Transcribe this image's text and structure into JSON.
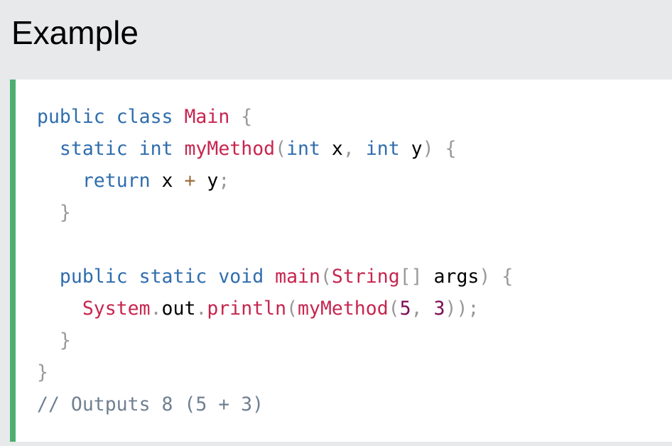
{
  "heading": "Example",
  "colors": {
    "page_background": "#e7e9eb",
    "code_background": "#ffffff",
    "accent_border": "#4caf70",
    "keyword": "#2f6dad",
    "name": "#c7254e",
    "punctuation": "#999999",
    "identifier": "#000000",
    "operator": "#9a6e3a",
    "number": "#7a0d55",
    "comment": "#708090"
  },
  "code": {
    "language": "java",
    "lines": [
      [
        {
          "t": "public",
          "k": "keyword"
        },
        {
          "t": " ",
          "k": "space"
        },
        {
          "t": "class",
          "k": "keyword"
        },
        {
          "t": " ",
          "k": "space"
        },
        {
          "t": "Main",
          "k": "name"
        },
        {
          "t": " ",
          "k": "space"
        },
        {
          "t": "{",
          "k": "punct"
        }
      ],
      [
        {
          "t": "  ",
          "k": "space"
        },
        {
          "t": "static",
          "k": "keyword"
        },
        {
          "t": " ",
          "k": "space"
        },
        {
          "t": "int",
          "k": "keyword"
        },
        {
          "t": " ",
          "k": "space"
        },
        {
          "t": "myMethod",
          "k": "name"
        },
        {
          "t": "(",
          "k": "punct"
        },
        {
          "t": "int",
          "k": "keyword"
        },
        {
          "t": " ",
          "k": "space"
        },
        {
          "t": "x",
          "k": "ident"
        },
        {
          "t": ",",
          "k": "punct"
        },
        {
          "t": " ",
          "k": "space"
        },
        {
          "t": "int",
          "k": "keyword"
        },
        {
          "t": " ",
          "k": "space"
        },
        {
          "t": "y",
          "k": "ident"
        },
        {
          "t": ")",
          "k": "punct"
        },
        {
          "t": " ",
          "k": "space"
        },
        {
          "t": "{",
          "k": "punct"
        }
      ],
      [
        {
          "t": "    ",
          "k": "space"
        },
        {
          "t": "return",
          "k": "keyword"
        },
        {
          "t": " ",
          "k": "space"
        },
        {
          "t": "x",
          "k": "ident"
        },
        {
          "t": " ",
          "k": "space"
        },
        {
          "t": "+",
          "k": "op"
        },
        {
          "t": " ",
          "k": "space"
        },
        {
          "t": "y",
          "k": "ident"
        },
        {
          "t": ";",
          "k": "punct"
        }
      ],
      [
        {
          "t": "  ",
          "k": "space"
        },
        {
          "t": "}",
          "k": "punct"
        }
      ],
      [],
      [
        {
          "t": "  ",
          "k": "space"
        },
        {
          "t": "public",
          "k": "keyword"
        },
        {
          "t": " ",
          "k": "space"
        },
        {
          "t": "static",
          "k": "keyword"
        },
        {
          "t": " ",
          "k": "space"
        },
        {
          "t": "void",
          "k": "keyword"
        },
        {
          "t": " ",
          "k": "space"
        },
        {
          "t": "main",
          "k": "name"
        },
        {
          "t": "(",
          "k": "punct"
        },
        {
          "t": "String",
          "k": "name"
        },
        {
          "t": "[]",
          "k": "punct"
        },
        {
          "t": " ",
          "k": "space"
        },
        {
          "t": "args",
          "k": "ident"
        },
        {
          "t": ")",
          "k": "punct"
        },
        {
          "t": " ",
          "k": "space"
        },
        {
          "t": "{",
          "k": "punct"
        }
      ],
      [
        {
          "t": "    ",
          "k": "space"
        },
        {
          "t": "System",
          "k": "name"
        },
        {
          "t": ".",
          "k": "punct"
        },
        {
          "t": "out",
          "k": "ident"
        },
        {
          "t": ".",
          "k": "punct"
        },
        {
          "t": "println",
          "k": "name"
        },
        {
          "t": "(",
          "k": "punct"
        },
        {
          "t": "myMethod",
          "k": "name"
        },
        {
          "t": "(",
          "k": "punct"
        },
        {
          "t": "5",
          "k": "number"
        },
        {
          "t": ",",
          "k": "punct"
        },
        {
          "t": " ",
          "k": "space"
        },
        {
          "t": "3",
          "k": "number"
        },
        {
          "t": "))",
          "k": "punct"
        },
        {
          "t": ";",
          "k": "punct"
        }
      ],
      [
        {
          "t": "  ",
          "k": "space"
        },
        {
          "t": "}",
          "k": "punct"
        }
      ],
      [
        {
          "t": "}",
          "k": "punct"
        }
      ],
      [
        {
          "t": "// Outputs 8 (5 + 3)",
          "k": "comment"
        }
      ]
    ]
  }
}
